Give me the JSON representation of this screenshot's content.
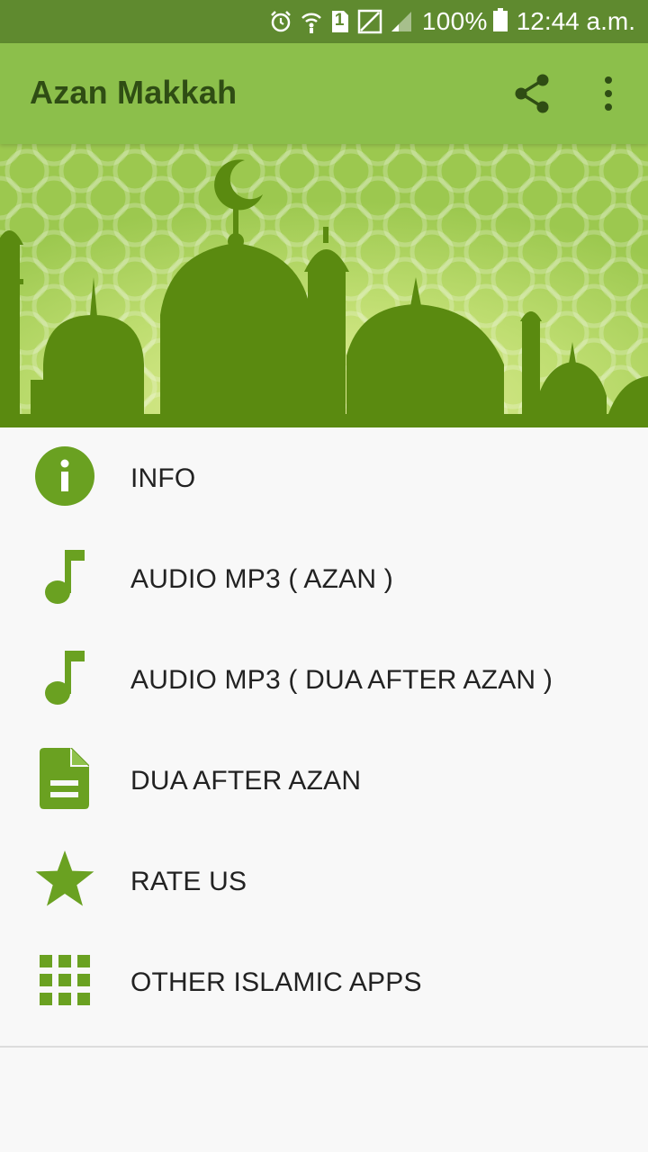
{
  "status_bar": {
    "battery": "100%",
    "time": "12:44 a.m.",
    "sim_label": "1",
    "icons": [
      "alarm-icon",
      "wifi-calling-icon",
      "sim-1-icon",
      "no-sim-icon",
      "signal-icon",
      "battery-icon"
    ]
  },
  "app_bar": {
    "title": "Azan Makkah",
    "actions": [
      "share-icon",
      "overflow-menu-icon"
    ]
  },
  "banner": {
    "image": "mosque-silhouette-banner"
  },
  "menu": {
    "items": [
      {
        "label": "INFO",
        "icon": "info-icon"
      },
      {
        "label": "AUDIO MP3 ( AZAN )",
        "icon": "music-note-icon"
      },
      {
        "label": "AUDIO MP3 ( DUA AFTER AZAN )",
        "icon": "music-note-icon"
      },
      {
        "label": "DUA AFTER AZAN",
        "icon": "document-icon"
      },
      {
        "label": "RATE US",
        "icon": "star-icon"
      },
      {
        "label": "OTHER ISLAMIC APPS",
        "icon": "apps-grid-icon"
      }
    ]
  },
  "colors": {
    "status_bar": "#5f8a2f",
    "app_bar": "#8cbf4b",
    "title_text": "#2f4d14",
    "accent": "#6aa121",
    "background": "#f8f8f8"
  }
}
